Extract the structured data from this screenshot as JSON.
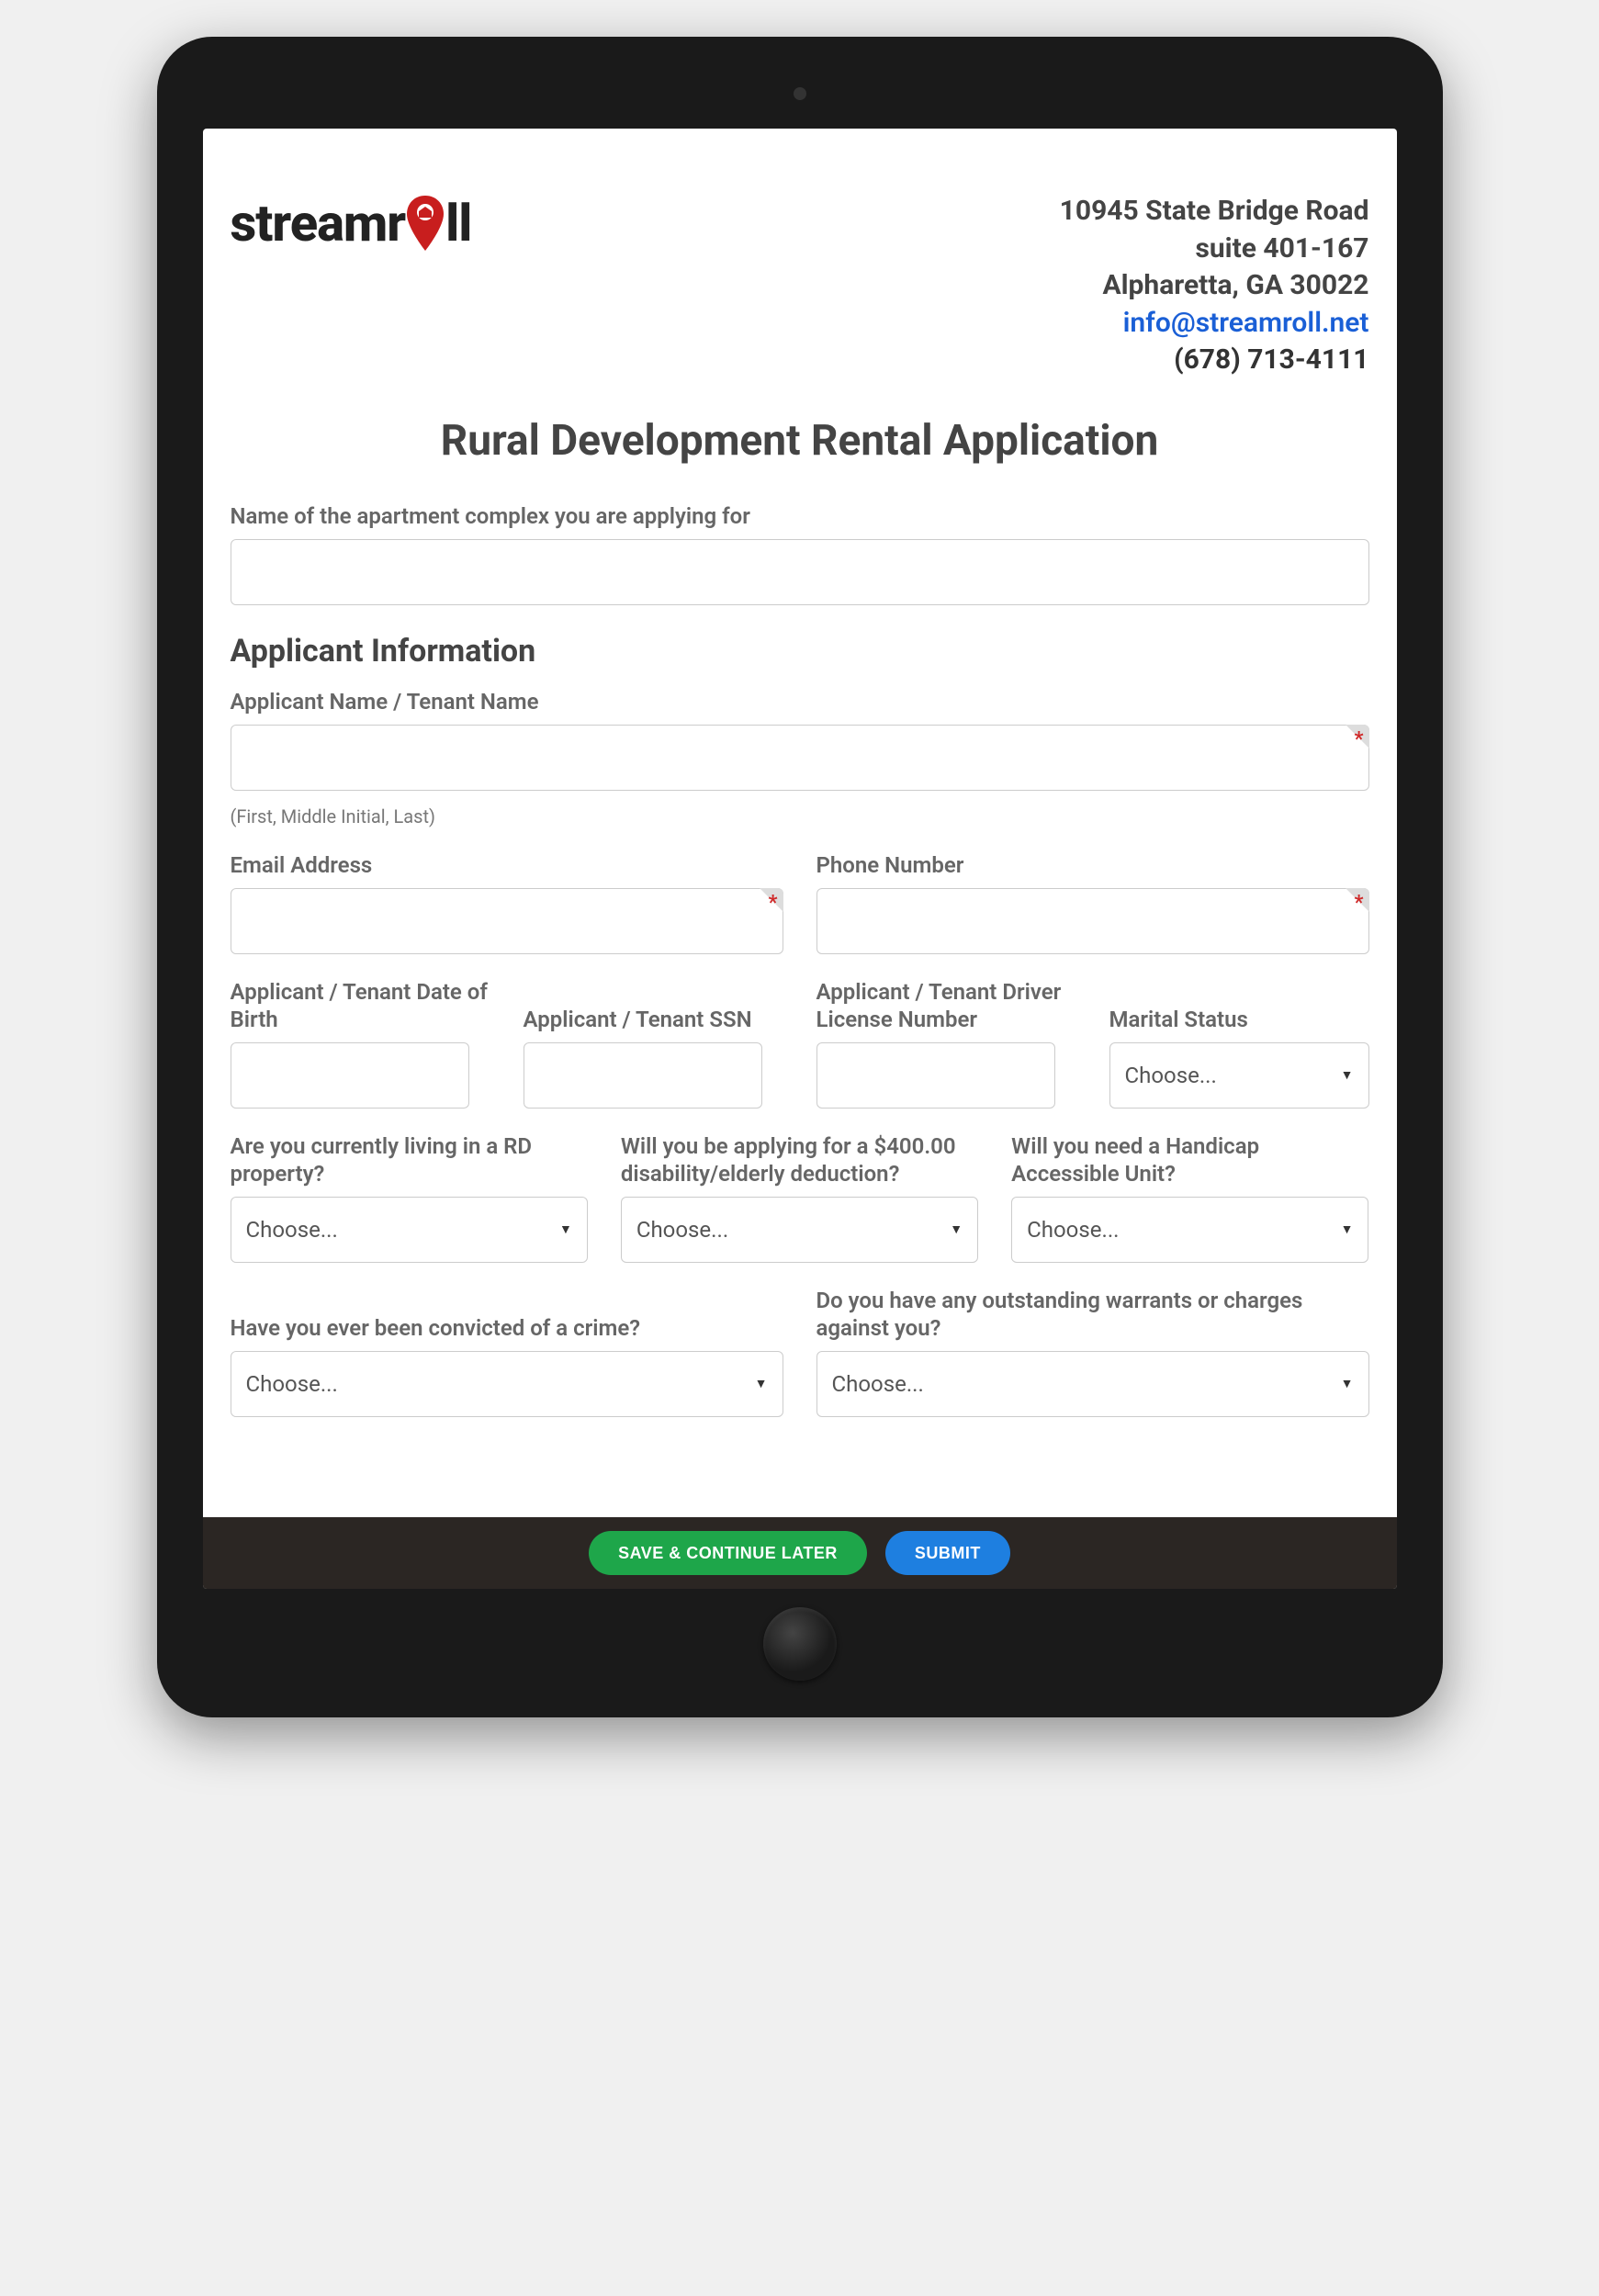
{
  "logo": {
    "part1": "streamr",
    "part2": "ll"
  },
  "address": {
    "line1": "10945 State Bridge Road",
    "line2": "suite 401-167",
    "line3": "Alpharetta, GA 30022",
    "email": "info@streamroll.net",
    "phone": "(678) 713-4111"
  },
  "title": "Rural Development Rental Application",
  "fields": {
    "complex_label": "Name of the apartment complex you are applying for",
    "section_applicant": "Applicant Information",
    "name_label": "Applicant Name / Tenant Name",
    "name_hint": "(First, Middle Initial, Last)",
    "email_label": "Email Address",
    "phone_label": "Phone Number",
    "dob_label": "Applicant / Tenant Date of Birth",
    "ssn_label": "Applicant / Tenant SSN",
    "dl_label": "Applicant / Tenant Driver License Number",
    "marital_label": "Marital Status",
    "rd_label": "Are you currently living in a RD property?",
    "deduction_label": "Will you be applying for a $400.00 disability/elderly deduction?",
    "handicap_label": "Will you need a Handicap Accessible Unit?",
    "crime_label": "Have you ever been convicted of a crime?",
    "warrants_label": "Do you have any outstanding warrants or charges against you?",
    "choose": "Choose..."
  },
  "buttons": {
    "save": "SAVE & CONTINUE LATER",
    "submit": "SUBMIT"
  }
}
